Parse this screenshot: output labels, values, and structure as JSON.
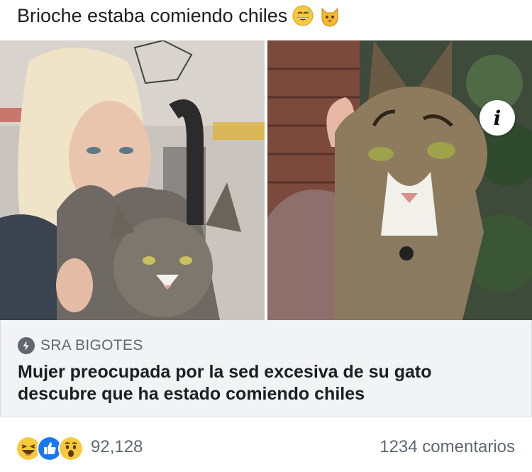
{
  "post": {
    "text": "Brioche estaba comiendo chiles",
    "emojis": [
      "grinning-sweat-emoji",
      "cat-face-emoji"
    ]
  },
  "media": {
    "info_label": "i"
  },
  "link": {
    "source": "SRA BIGOTES",
    "headline": "Mujer preocupada por la sed excesiva de su gato descubre que ha estado comiendo chiles"
  },
  "reactions": {
    "icons": [
      "haha-reaction-icon",
      "like-reaction-icon",
      "wow-reaction-icon"
    ],
    "count": "92,128"
  },
  "comments": {
    "label": "1234 comentarios"
  },
  "colors": {
    "secondary_text": "#606770",
    "card_bg": "#f2f3f5",
    "like_blue": "#1877f2",
    "emoji_yellow": "#f7c93b"
  }
}
